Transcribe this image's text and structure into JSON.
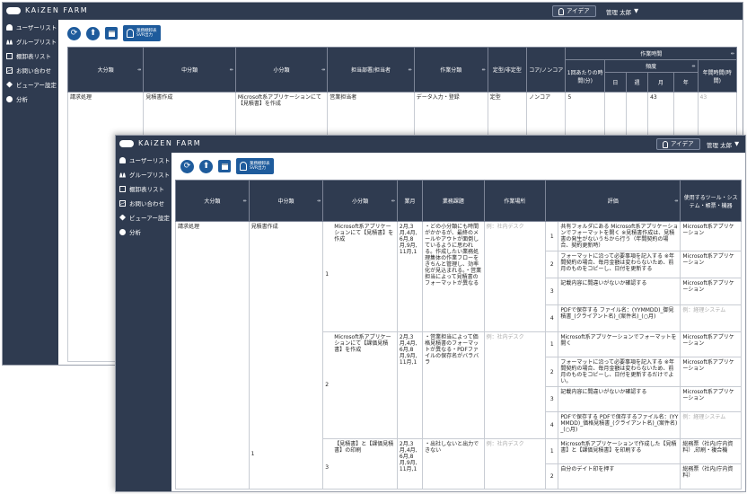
{
  "brand": "KAiZEN FARM",
  "idea_label": "アイデア",
  "user_label": "管理 太郎",
  "sidebar": {
    "items": [
      {
        "label": "ユーザーリスト",
        "icon": "user-icon"
      },
      {
        "label": "グループリスト",
        "icon": "group-icon"
      },
      {
        "label": "棚卸表リスト",
        "icon": "list-icon"
      },
      {
        "label": "お問い合わせ",
        "icon": "mail-icon"
      },
      {
        "label": "ビューアー設定",
        "icon": "viewer-icon"
      },
      {
        "label": "分析",
        "icon": "dot-icon"
      }
    ]
  },
  "toolbar": {
    "special_line1": "業務棚卸表",
    "special_line2": "SVR出力"
  },
  "back_table": {
    "headers": {
      "major": "大分類",
      "middle": "中分類",
      "minor": "小分類",
      "dept": "担当部署/担当者",
      "work_type": "作業分類",
      "routine": "定型/非定型",
      "core": "コア/ノンコア",
      "work_time": "作業時間",
      "per_time": "1回あたりの時間(分)",
      "frequency": "頻度",
      "annual": "年間時間(時間)",
      "f_day": "日",
      "f_week": "週",
      "f_month": "月",
      "f_year": "年"
    },
    "row": {
      "major": "請求処理",
      "middle": "見積書作成",
      "minor": "Microsoft系アプリケーションにて【見積書】を作成",
      "dept": "営業担当者",
      "work_type": "データ入力・登録",
      "routine": "定型",
      "core": "ノンコア",
      "per_time": "5",
      "f_month": "43",
      "annual": "43"
    }
  },
  "front_table": {
    "headers": {
      "major": "大分類",
      "middle": "中分類",
      "minor": "小分類",
      "month": "業月",
      "issues": "業務課題",
      "location": "作業場所",
      "evaluation": "評価",
      "tools": "使用するツール・システム・帳票・機器"
    },
    "major": "請求処理",
    "middle": "見積書作成",
    "middle_num": "1",
    "groups": [
      {
        "num": "1",
        "minor": "Microsoft系アプリケーションにて【見積書】を作成",
        "month": "2月,3月,4月,6月,8月,9月,11月,1",
        "issues": "・どの小分類にも時間がかかるが、最終のメールやアウトが面倒しているように思われる。作成したい業務処理集体の作業フローをきちんと管理し、効率化が見込まれる。・営業担当によって見積書のフォーマットが異なる",
        "location": "例：社内デスク",
        "items": [
          {
            "n": "1",
            "text": "共有フォルダにある Microsoft系アプリケーションでフォーマットを開く ※見積書作成は、見積書の発生がないうちから行う（年間契約の場合、契約更新時）",
            "tool": "Microsoft系アプリケーション"
          },
          {
            "n": "2",
            "text": "フォーマットに沿って必要事項を記入する ※年間契約の場合、毎月金額は変わらないため、前月のものをコピーし、日付を更新する",
            "tool": "Microsoft系アプリケーション"
          },
          {
            "n": "3",
            "text": "記載内容に間違いがないか確認する",
            "tool": "Microsoft系アプリケーション"
          },
          {
            "n": "4",
            "text": "PDFで保存する ファイル名：(YYMMDD)_御見積書_(クライアント名)_(案件名)_(○月)",
            "tool": "例：経理システム"
          }
        ]
      },
      {
        "num": "2",
        "minor": "Microsoft系アプリケーションにて【課価見積書】を作成",
        "month": "2月,3月,4月,6月,8月,9月,11月,1",
        "issues": "・営業担当によって価格見積書のフォーマットが異なる・PDFファイルの保存名がバラバラ",
        "location": "例：社内デスク",
        "items": [
          {
            "n": "1",
            "text": "Microsoft系アプリケーションでフォーマットを開く",
            "tool": "Microsoft系アプリケーション"
          },
          {
            "n": "2",
            "text": "フォーマットに沿って必要事項を記入する ※年間契約の場合、毎月金額は変わらないため、前月のものをコピーし、日付を更新するだけでよい。",
            "tool": "Microsoft系アプリケーション"
          },
          {
            "n": "3",
            "text": "記載内容に間違いがないか確認する",
            "tool": "Microsoft系アプリケーション"
          },
          {
            "n": "4",
            "text": "PDFで保存する PDFで保存するファイル名：(YYMMDD)_価格見積書_(クライアント名)_(案件名)_(○月)",
            "tool": "例：経理システム"
          }
        ]
      },
      {
        "num": "3",
        "minor": "【見積書】と【課価見積書】の印刷",
        "month": "2月,3月,4月,6月,8月,9月,11月,1",
        "issues": "・出社しないと出力できない",
        "location": "例：社内デスク",
        "items": [
          {
            "n": "1",
            "text": "Microsoft系アプリケーションで作成した【見積書】と【課価見積書】を印刷する",
            "tool": "総務票（社内/庁内資料）,印刷・複合機"
          },
          {
            "n": "2",
            "text": "自分のデイト印を押す",
            "tool": "総務票（社内/庁内資料）"
          }
        ]
      }
    ]
  }
}
